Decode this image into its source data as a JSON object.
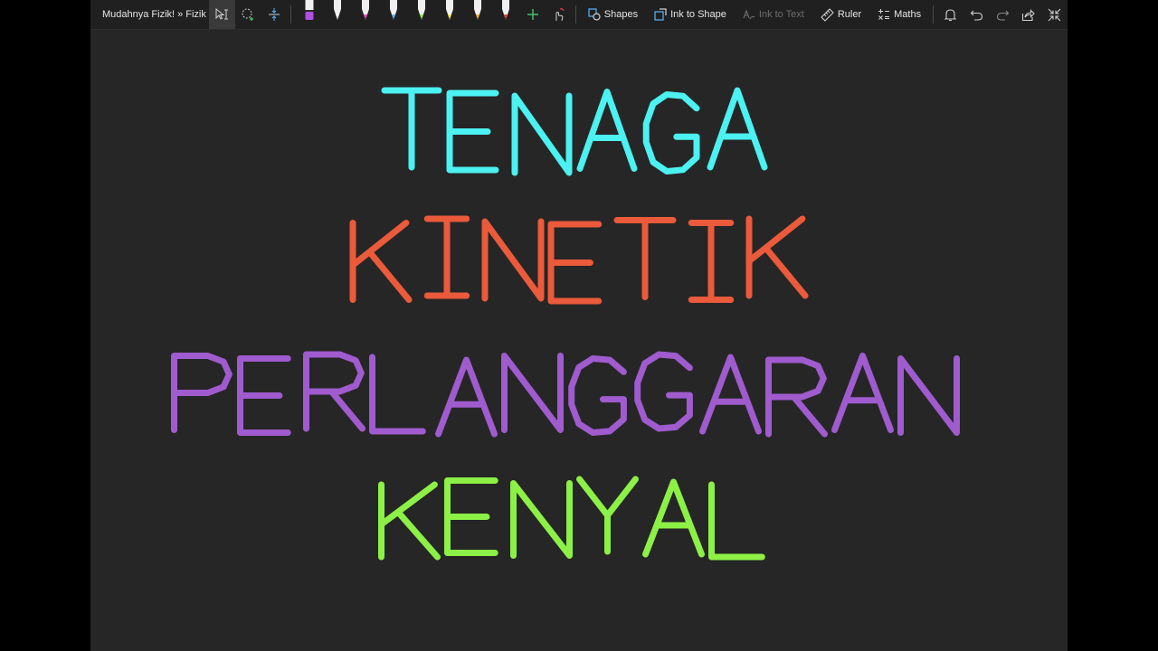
{
  "breadcrumb": {
    "notebook": "Mudahnya Fizik!",
    "separator": "»",
    "section": "Fizik"
  },
  "toolbar": {
    "shapes_label": "Shapes",
    "ink_to_shape_label": "Ink to Shape",
    "ink_to_text_label": "Ink to Text",
    "ruler_label": "Ruler",
    "maths_label": "Maths"
  },
  "pens": [
    {
      "name": "highlighter-purple",
      "color": "#b04fe0",
      "kind": "highlighter"
    },
    {
      "name": "pen-white",
      "color": "#ffffff",
      "kind": "pen"
    },
    {
      "name": "pen-pink",
      "color": "#ff3cd6",
      "kind": "pen"
    },
    {
      "name": "pen-light-blue",
      "color": "#56b6ff",
      "kind": "pen"
    },
    {
      "name": "pen-green",
      "color": "#8cf23d",
      "kind": "pen"
    },
    {
      "name": "pen-yellow",
      "color": "#f5f23a",
      "kind": "pen"
    },
    {
      "name": "pen-orange",
      "color": "#f5b02a",
      "kind": "pen"
    },
    {
      "name": "pen-red",
      "color": "#ee3b3b",
      "kind": "pen"
    }
  ],
  "ink_words": [
    {
      "text": "TENAGA",
      "color": "#4cf1f1"
    },
    {
      "text": "KINETIK",
      "color": "#ea5a3b"
    },
    {
      "text": "PERLANGGARAN",
      "color": "#a05bcf"
    },
    {
      "text": "KENYAL",
      "color": "#8df046"
    }
  ],
  "colors": {
    "canvas": "#262626",
    "toolbar": "#202020",
    "add_pen": "#4cc36a"
  },
  "icons": [
    "lasso-select-icon",
    "add-space-icon",
    "insert-space-icon",
    "add-pen-icon",
    "touch-draw-icon",
    "shapes-icon",
    "ink-to-shape-icon",
    "ink-to-text-icon",
    "ruler-icon",
    "maths-icon",
    "bell-icon",
    "undo-icon",
    "redo-icon",
    "share-icon",
    "collapse-icon"
  ]
}
